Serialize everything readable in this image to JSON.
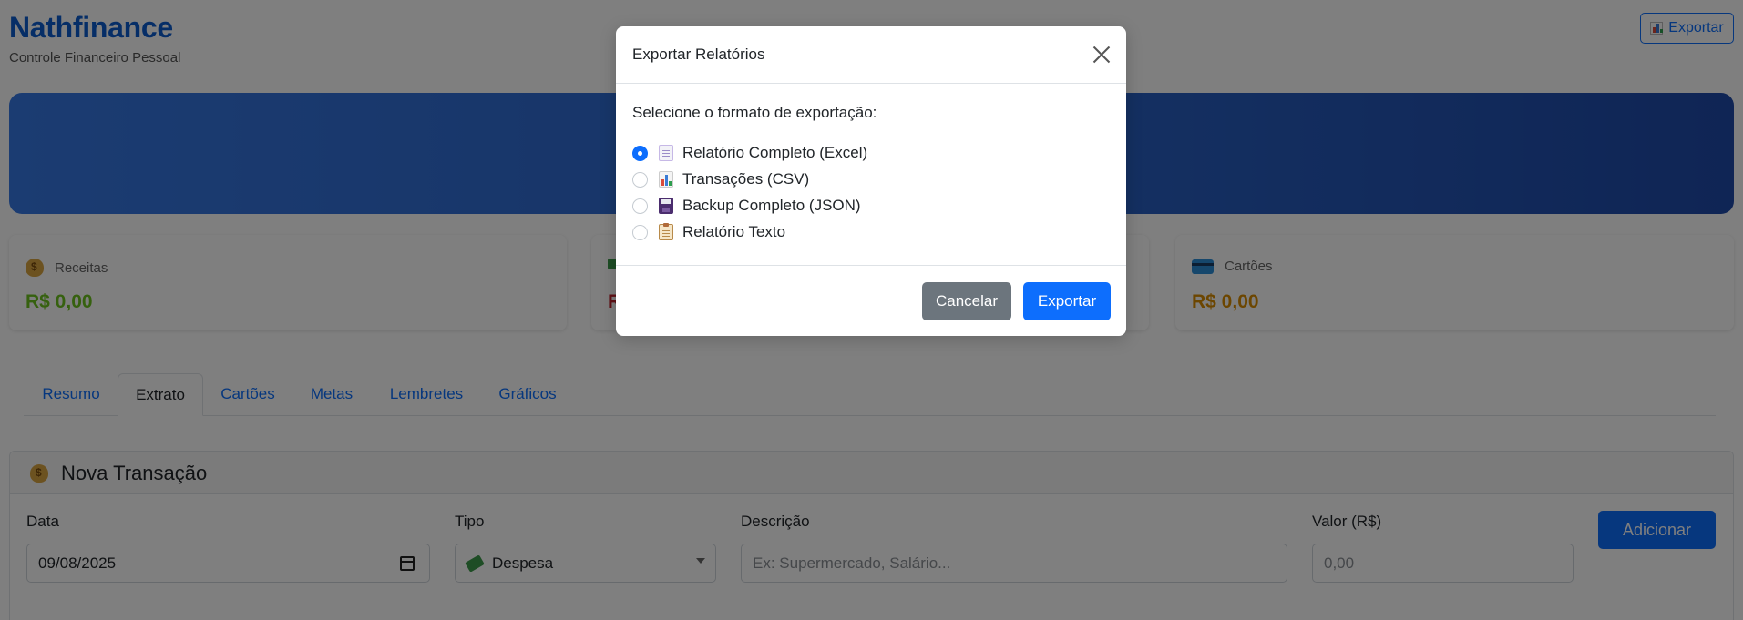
{
  "app": {
    "title": "Nathfinance",
    "subtitle": "Controle Financeiro Pessoal",
    "export_button_label": "Exportar"
  },
  "summary": {
    "cards": [
      {
        "label": "Receitas",
        "value": "R$ 0,00",
        "icon": "money-bag-icon",
        "color": "#6cc21f"
      },
      {
        "label": "",
        "value": "R",
        "icon": "money-icon",
        "color": "#c0202a"
      },
      {
        "label": "Cartões",
        "value": "R$ 0,00",
        "icon": "credit-card-icon",
        "color": "#d98c00"
      }
    ]
  },
  "tabs": [
    {
      "label": "Resumo",
      "active": false
    },
    {
      "label": "Extrato",
      "active": true
    },
    {
      "label": "Cartões",
      "active": false
    },
    {
      "label": "Metas",
      "active": false
    },
    {
      "label": "Lembretes",
      "active": false
    },
    {
      "label": "Gráficos",
      "active": false
    }
  ],
  "new_transaction": {
    "title": "Nova Transação",
    "icon": "money-bag-icon",
    "fields": {
      "date": {
        "label": "Data",
        "value": "09/08/2025"
      },
      "type": {
        "label": "Tipo",
        "value": "Despesa"
      },
      "description": {
        "label": "Descrição",
        "placeholder": "Ex: Supermercado, Salário..."
      },
      "amount": {
        "label": "Valor (R$)",
        "placeholder": "0,00"
      }
    },
    "add_button_label": "Adicionar"
  },
  "modal": {
    "title": "Exportar Relatórios",
    "prompt": "Selecione o formato de exportação:",
    "options": [
      {
        "label": "Relatório Completo (Excel)",
        "icon": "document-icon",
        "selected": true
      },
      {
        "label": "Transações (CSV)",
        "icon": "bar-chart-icon",
        "selected": false
      },
      {
        "label": "Backup Completo (JSON)",
        "icon": "floppy-disk-icon",
        "selected": false
      },
      {
        "label": "Relatório Texto",
        "icon": "clipboard-icon",
        "selected": false
      }
    ],
    "cancel_label": "Cancelar",
    "export_label": "Exportar"
  },
  "colors": {
    "brand": "#0d5ccf",
    "primary": "#0d6efd",
    "secondary": "#6c757d"
  }
}
